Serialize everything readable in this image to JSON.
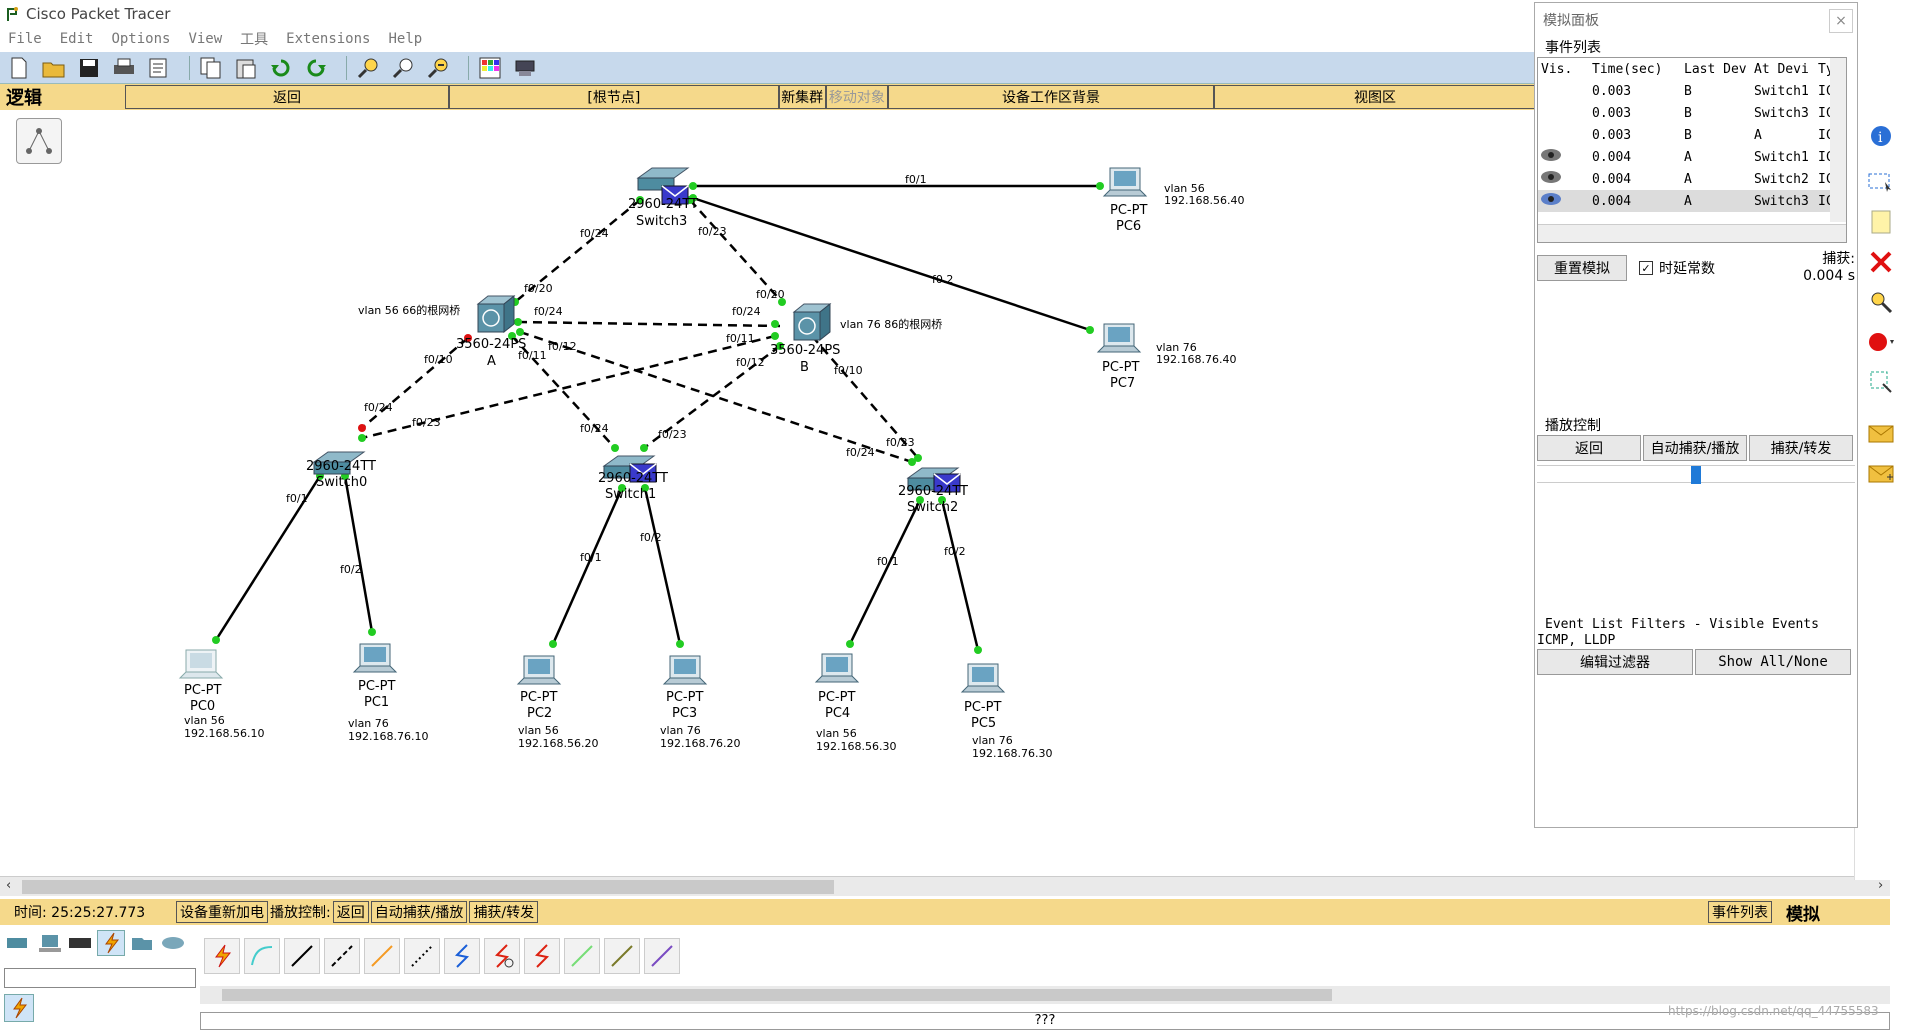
{
  "app": {
    "title": "Cisco Packet Tracer"
  },
  "menu": [
    "File",
    "Edit",
    "Options",
    "View",
    "工具",
    "Extensions",
    "Help"
  ],
  "workspace": {
    "logic_label": "逻辑",
    "back": "返回",
    "root": "[根节点]",
    "new_cluster": "新集群",
    "move_object": "移动对象",
    "background": "设备工作区背景",
    "viewport": "视图区"
  },
  "topology": {
    "devices": {
      "switch3": {
        "model": "2960-24TT",
        "name": "Switch3"
      },
      "switch0": {
        "model": "2960-24TT",
        "name": "Switch0"
      },
      "switch1": {
        "model": "2960-24TT",
        "name": "Switch1"
      },
      "switch2": {
        "model": "2960-24TT",
        "name": "Switch2"
      },
      "mlsA": {
        "model": "3560-24PS",
        "name": "A",
        "note": "vlan 56 66的根网桥"
      },
      "mlsB": {
        "model": "3560-24PS",
        "name": "B",
        "note": "vlan 76 86的根网桥"
      },
      "pc0": {
        "model": "PC-PT",
        "name": "PC0",
        "vlan": "vlan 56",
        "ip": "192.168.56.10"
      },
      "pc1": {
        "model": "PC-PT",
        "name": "PC1",
        "vlan": "vlan 76",
        "ip": "192.168.76.10"
      },
      "pc2": {
        "model": "PC-PT",
        "name": "PC2",
        "vlan": "vlan 56",
        "ip": "192.168.56.20"
      },
      "pc3": {
        "model": "PC-PT",
        "name": "PC3",
        "vlan": "vlan 76",
        "ip": "192.168.76.20"
      },
      "pc4": {
        "model": "PC-PT",
        "name": "PC4",
        "vlan": "vlan 56",
        "ip": "192.168.56.30"
      },
      "pc5": {
        "model": "PC-PT",
        "name": "PC5",
        "vlan": "vlan 76",
        "ip": "192.168.76.30"
      },
      "pc6": {
        "model": "PC-PT",
        "name": "PC6",
        "vlan": "vlan 56",
        "ip": "192.168.56.40"
      },
      "pc7": {
        "model": "PC-PT",
        "name": "PC7",
        "vlan": "vlan 76",
        "ip": "192.168.76.40"
      }
    },
    "port_labels": {
      "s3_pc6": "f0/1",
      "s3_pc7": "f0.2",
      "s3_a": "f0/24",
      "s3_b": "f0/23",
      "a_s3": "f0/20",
      "b_s3": "f0/20",
      "a_b": "f0/24",
      "b_a": "f0/24",
      "a_s0": "f0/10",
      "s0_a": "f0/24",
      "b_s0": "f0/11",
      "s0_b": "f0/23",
      "a_s1": "f0/11",
      "s1_a": "f0/24",
      "b_s1": "f0/12",
      "s1_b": "f0/23",
      "a_s2": "f0/12",
      "s2_a": "f0/24",
      "b_s2": "f0/10",
      "s2_b": "f0/23",
      "s0_pc0": "f0/1",
      "s0_pc1": "f0/2",
      "s1_pc2": "f0/1",
      "s1_pc3": "f0/2",
      "s2_pc4": "f0/1",
      "s2_pc5": "f0/2"
    }
  },
  "sim_panel": {
    "title": "模拟面板",
    "event_list_label": "事件列表",
    "columns": [
      "Vis.",
      "Time(sec)",
      "Last Dev",
      "At Devi",
      "Ty"
    ],
    "events": [
      {
        "vis": "",
        "time": "0.003",
        "last": "B",
        "at": "Switch1",
        "type": "IC"
      },
      {
        "vis": "",
        "time": "0.003",
        "last": "B",
        "at": "Switch3",
        "type": "IC"
      },
      {
        "vis": "",
        "time": "0.003",
        "last": "B",
        "at": "A",
        "type": "IC"
      },
      {
        "vis": "eye",
        "time": "0.004",
        "last": "A",
        "at": "Switch1",
        "type": "IC"
      },
      {
        "vis": "eye",
        "time": "0.004",
        "last": "A",
        "at": "Switch2",
        "type": "IC"
      },
      {
        "vis": "eye",
        "time": "0.004",
        "last": "A",
        "at": "Switch3",
        "type": "IC"
      }
    ],
    "reset": "重置模拟",
    "constant_delay": "时延常数",
    "capture_label": "捕获:",
    "capture_value": "0.004 s",
    "play_controls": "播放控制",
    "back": "返回",
    "auto_capture": "自动捕获/播放",
    "capture_forward": "捕获/转发",
    "filters_title": "Event List Filters - Visible Events",
    "filters_value": "ICMP, LLDP",
    "edit_filters": "编辑过滤器",
    "show_all": "Show All/None"
  },
  "statusbar": {
    "time": "时间: 25:25:27.773",
    "power_cycle": "设备重新加电",
    "play_control": "播放控制:",
    "back": "返回",
    "auto": "自动捕获/播放",
    "capture": "捕获/转发",
    "event_list": "事件列表",
    "sim_mode": "模拟"
  },
  "bottom": {
    "description": "???"
  },
  "watermark": "https://blog.csdn.net/qq_44755583",
  "colors": {
    "link_up": "#22cc22",
    "link_down": "#dd1111",
    "workbar": "#f5d98b",
    "toolbar": "#c7d9ec"
  }
}
